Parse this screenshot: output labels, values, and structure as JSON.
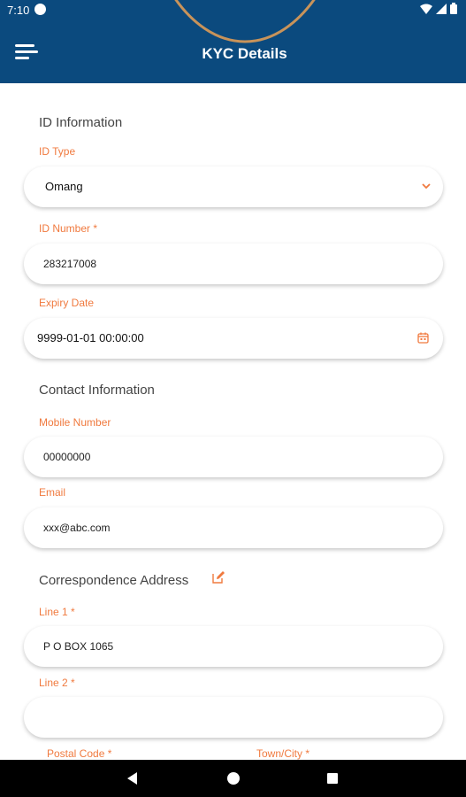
{
  "status_bar": {
    "time": "7:10",
    "icons": [
      "app-notification-icon",
      "wifi-icon",
      "signal-icon",
      "battery-icon"
    ]
  },
  "header": {
    "title": "KYC Details",
    "menu_icon": "hamburger-menu-icon",
    "background_color": "#0b4a7e",
    "accent_arc_color": "#c8935a"
  },
  "id_information": {
    "section_title": "ID Information",
    "id_type": {
      "label": "ID Type",
      "value": "Omang"
    },
    "id_number": {
      "label": "ID Number *",
      "value": "283217008"
    },
    "expiry_date": {
      "label": "Expiry Date",
      "value": "9999-01-01 00:00:00"
    }
  },
  "contact_information": {
    "section_title": "Contact Information",
    "mobile_number": {
      "label": "Mobile Number",
      "value": "00000000"
    },
    "email": {
      "label": "Email",
      "value": "xxx@abc.com"
    }
  },
  "correspondence_address": {
    "section_title": "Correspondence Address",
    "line1": {
      "label": "Line 1 *",
      "value": "P O BOX 1065"
    },
    "line2": {
      "label": "Line 2 *",
      "value": ""
    },
    "postal_code": {
      "label": "Postal Code *"
    },
    "town_city": {
      "label": "Town/City *"
    }
  },
  "colors": {
    "label_color": "#f07a3f",
    "accent": "#f07a3f"
  },
  "nav_bar": {
    "icons": [
      "back-icon",
      "home-icon",
      "recent-apps-icon"
    ]
  }
}
